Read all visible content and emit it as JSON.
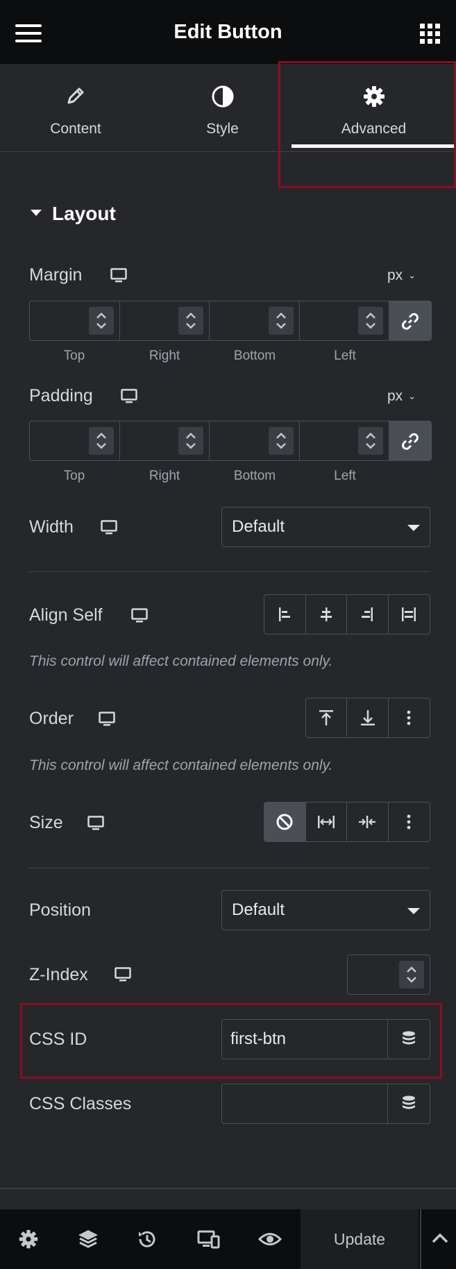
{
  "header": {
    "title": "Edit Button",
    "menu_icon": "hamburger-icon",
    "apps_icon": "grid-icon"
  },
  "tabs": [
    {
      "label": "Content",
      "icon": "pencil-icon"
    },
    {
      "label": "Style",
      "icon": "half-circle-icon"
    },
    {
      "label": "Advanced",
      "icon": "gear-icon",
      "active": true
    }
  ],
  "section": {
    "title": "Layout"
  },
  "margin": {
    "label": "Margin",
    "unit": "px",
    "sides": [
      "Top",
      "Right",
      "Bottom",
      "Left"
    ],
    "values": [
      "",
      "",
      "",
      ""
    ]
  },
  "padding": {
    "label": "Padding",
    "unit": "px",
    "sides": [
      "Top",
      "Right",
      "Bottom",
      "Left"
    ],
    "values": [
      "",
      "",
      "",
      ""
    ]
  },
  "width": {
    "label": "Width",
    "value": "Default"
  },
  "align_self": {
    "label": "Align Self",
    "note": "This control will affect contained elements only."
  },
  "order": {
    "label": "Order",
    "note": "This control will affect contained elements only."
  },
  "size": {
    "label": "Size"
  },
  "position": {
    "label": "Position",
    "value": "Default"
  },
  "zindex": {
    "label": "Z-Index",
    "value": ""
  },
  "css_id": {
    "label": "CSS ID",
    "value": "first-btn"
  },
  "css_classes": {
    "label": "CSS Classes",
    "value": ""
  },
  "footer": {
    "update_label": "Update"
  },
  "colors": {
    "background": "#26272b",
    "header": "#0c0d0e",
    "highlight": "#8b0d26"
  }
}
